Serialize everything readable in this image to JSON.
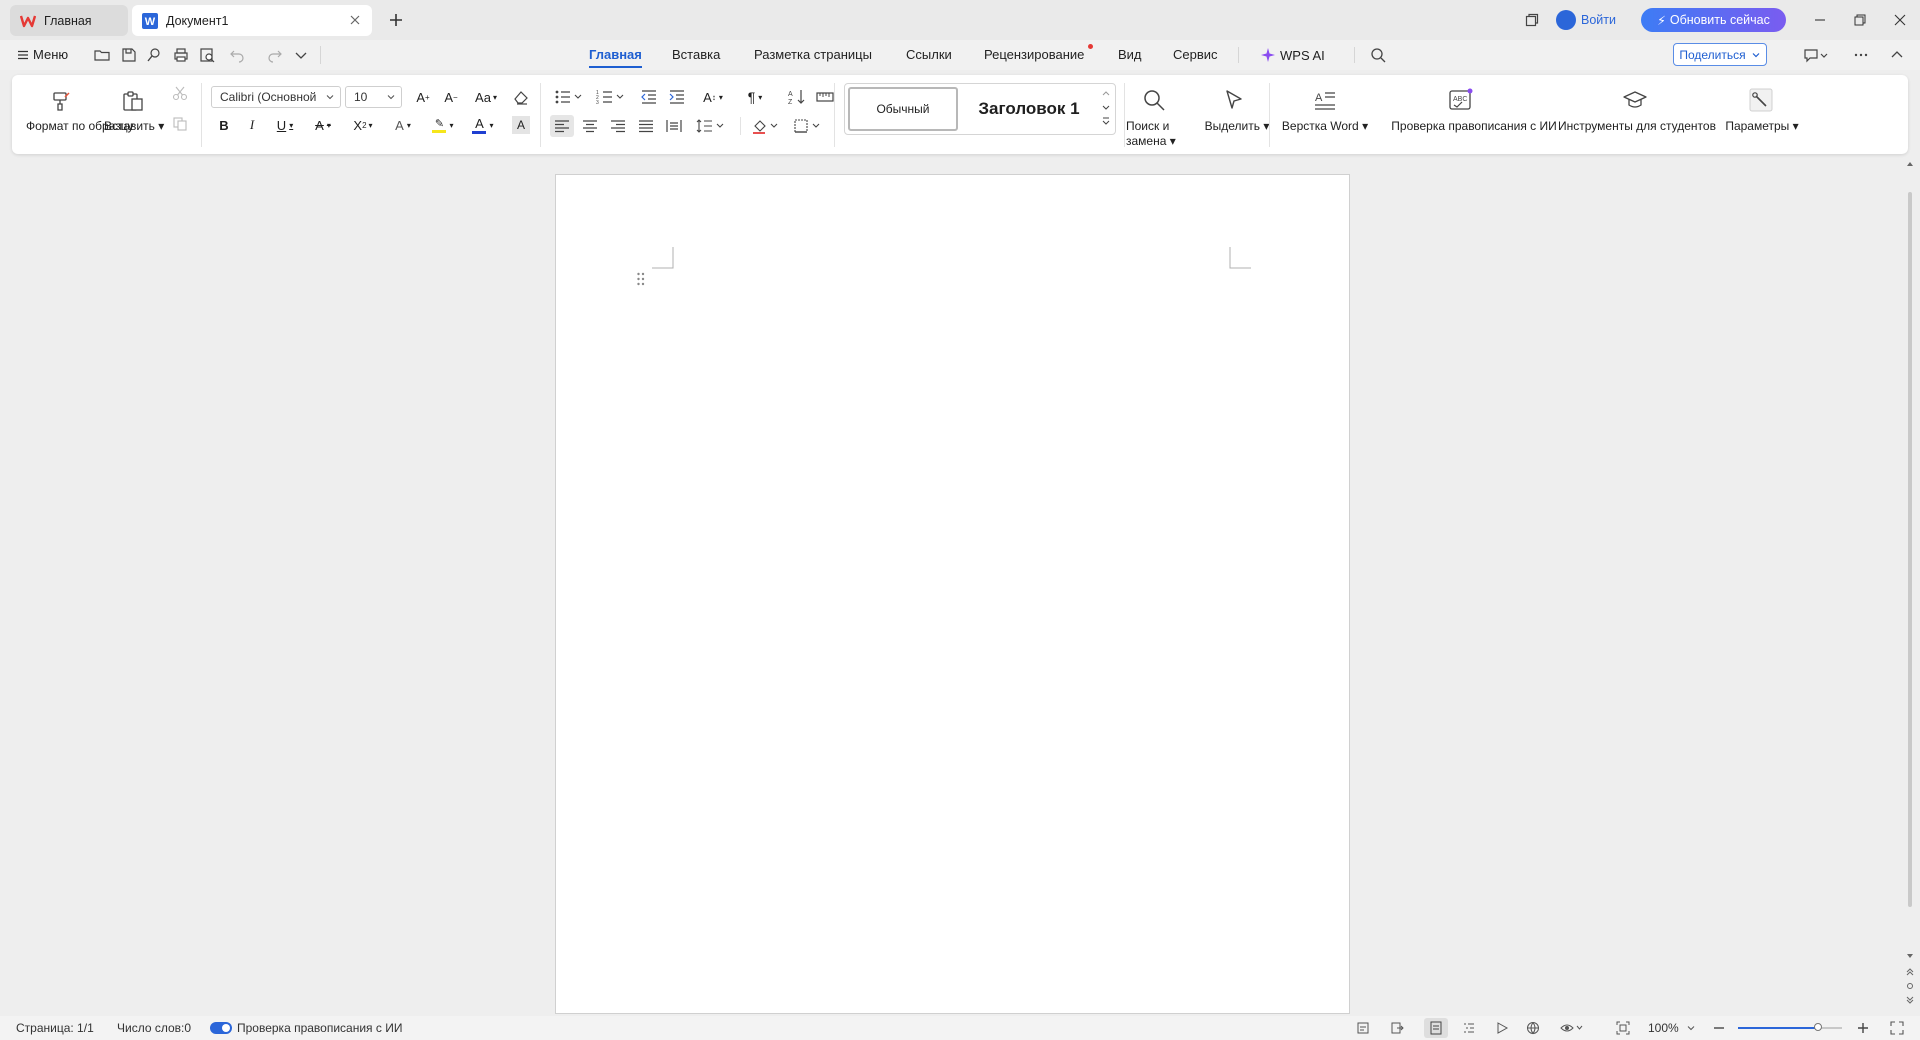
{
  "colors": {
    "accent": "#1f5fd1",
    "brand_red": "#e53935",
    "upgrade_gradient": [
      "#3d7cf5",
      "#7a5cf0"
    ]
  },
  "tabs": [
    {
      "label": "Главная",
      "icon": "wps-logo-icon"
    },
    {
      "label": "Документ1",
      "icon": "word-doc-icon"
    }
  ],
  "titlebar": {
    "login_label": "Войти",
    "upgrade_label": "Обновить сейчас"
  },
  "menubar": {
    "menu_label": "Меню",
    "ribbon_tabs": [
      "Главная",
      "Вставка",
      "Разметка страницы",
      "Ссылки",
      "Рецензирование",
      "Вид",
      "Сервис",
      "WPS AI"
    ],
    "active_tab": "Главная",
    "share_label": "Поделиться"
  },
  "ribbon": {
    "format_painter": "Формат по образцу",
    "paste": "Вставить",
    "font_name": "Calibri (Основной",
    "font_size": "10",
    "style_normal": "Обычный",
    "style_heading": "Заголовок 1",
    "find_replace": "Поиск и замена",
    "select": "Выделить",
    "word_layout": "Верстка Word",
    "ai_spell": "Проверка правописания с ИИ",
    "student_tools": "Инструменты для студентов",
    "params": "Параметры"
  },
  "status": {
    "page": "Страница: 1/1",
    "words": "Число слов:0",
    "ai_spell": "Проверка правописания с ИИ",
    "zoom": "100%",
    "zoom_level": 1.0
  }
}
